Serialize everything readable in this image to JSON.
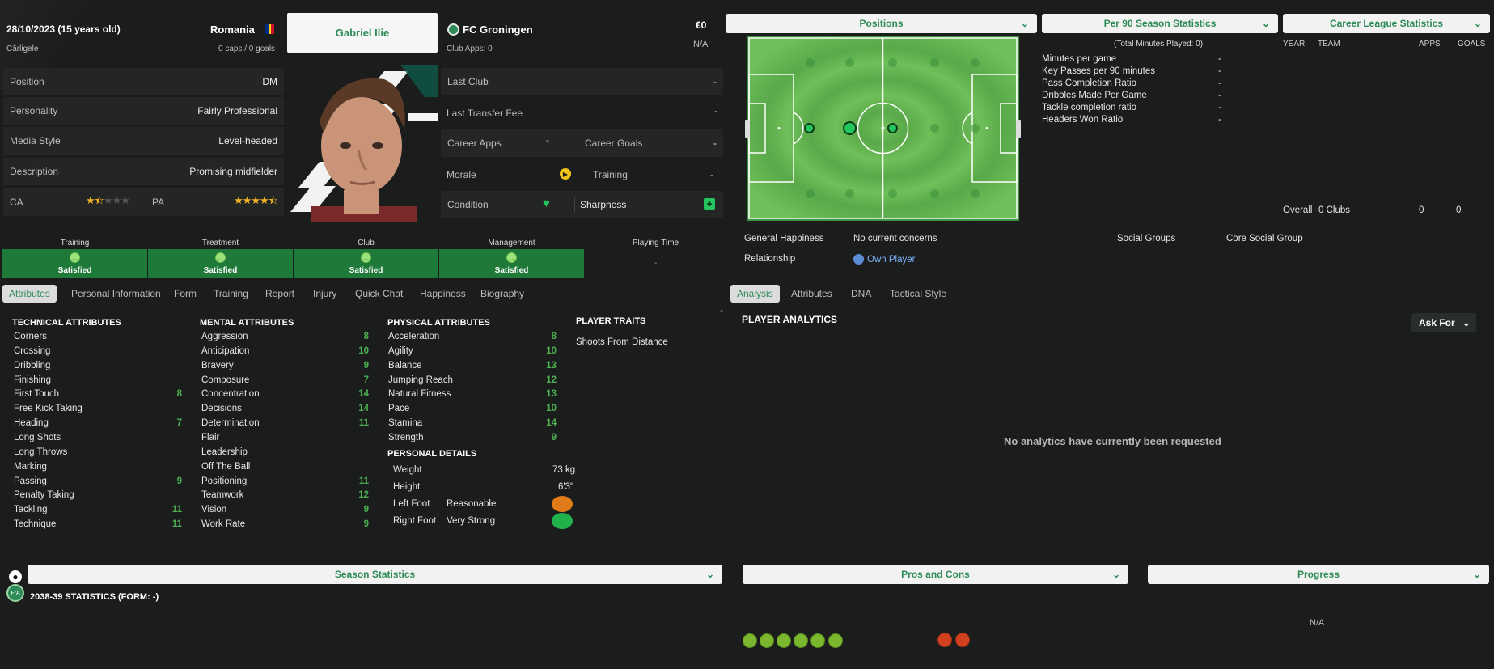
{
  "profile": {
    "dob": "28/10/2023 (15 years old)",
    "birthplace": "Cărligele",
    "nation": "Romania",
    "caps": "0 caps / 0 goals",
    "name": "Gabriel Ilie",
    "rows": [
      {
        "label": "Position",
        "value": "DM"
      },
      {
        "label": "Personality",
        "value": "Fairly Professional"
      },
      {
        "label": "Media Style",
        "value": "Level-headed"
      },
      {
        "label": "Description",
        "value": "Promising midfielder"
      }
    ],
    "ca_label": "CA",
    "pa_label": "PA",
    "ca_stars": 1.5,
    "pa_stars": 4.5
  },
  "club": {
    "name": "FC Groningen",
    "apps": "Club Apps: 0",
    "value": "€0",
    "contract": "N/A",
    "last_club_label": "Last Club",
    "last_club_value": "-",
    "last_fee_label": "Last Transfer Fee",
    "last_fee_value": "-",
    "career_apps_label": "Career Apps",
    "career_apps_value": "-",
    "career_goals_label": "Career Goals",
    "career_goals_value": "-",
    "morale_label": "Morale",
    "training_label": "Training",
    "training_value": "-",
    "condition_label": "Condition",
    "sharpness_label": "Sharpness"
  },
  "status": {
    "items": [
      {
        "label": "Training",
        "value": "Satisfied"
      },
      {
        "label": "Treatment",
        "value": "Satisfied"
      },
      {
        "label": "Club",
        "value": "Satisfied"
      },
      {
        "label": "Management",
        "value": "Satisfied"
      }
    ],
    "playing_time_label": "Playing Time",
    "playing_time_value": "-"
  },
  "tabs_left": [
    "Attributes",
    "Personal Information",
    "Form",
    "Training",
    "Report",
    "Injury",
    "Quick Chat",
    "Happiness",
    "Biography"
  ],
  "tabs_right": [
    "Analysis",
    "Attributes",
    "DNA",
    "Tactical Style"
  ],
  "technical": {
    "heading": "TECHNICAL ATTRIBUTES",
    "items": [
      {
        "name": "Corners",
        "value": ""
      },
      {
        "name": "Crossing",
        "value": ""
      },
      {
        "name": "Dribbling",
        "value": ""
      },
      {
        "name": "Finishing",
        "value": ""
      },
      {
        "name": "First Touch",
        "value": "8"
      },
      {
        "name": "Free Kick Taking",
        "value": ""
      },
      {
        "name": "Heading",
        "value": "7"
      },
      {
        "name": "Long Shots",
        "value": ""
      },
      {
        "name": "Long Throws",
        "value": ""
      },
      {
        "name": "Marking",
        "value": ""
      },
      {
        "name": "Passing",
        "value": "9"
      },
      {
        "name": "Penalty Taking",
        "value": ""
      },
      {
        "name": "Tackling",
        "value": "11"
      },
      {
        "name": "Technique",
        "value": "11"
      }
    ]
  },
  "mental": {
    "heading": "MENTAL ATTRIBUTES",
    "items": [
      {
        "name": "Aggression",
        "value": "8"
      },
      {
        "name": "Anticipation",
        "value": "10"
      },
      {
        "name": "Bravery",
        "value": "9"
      },
      {
        "name": "Composure",
        "value": "7"
      },
      {
        "name": "Concentration",
        "value": "14"
      },
      {
        "name": "Decisions",
        "value": "14"
      },
      {
        "name": "Determination",
        "value": "11"
      },
      {
        "name": "Flair",
        "value": ""
      },
      {
        "name": "Leadership",
        "value": ""
      },
      {
        "name": "Off The Ball",
        "value": ""
      },
      {
        "name": "Positioning",
        "value": "11"
      },
      {
        "name": "Teamwork",
        "value": "12"
      },
      {
        "name": "Vision",
        "value": "9"
      },
      {
        "name": "Work Rate",
        "value": "9"
      }
    ]
  },
  "physical": {
    "heading": "PHYSICAL ATTRIBUTES",
    "items": [
      {
        "name": "Acceleration",
        "value": "8"
      },
      {
        "name": "Agility",
        "value": "10"
      },
      {
        "name": "Balance",
        "value": "13"
      },
      {
        "name": "Jumping Reach",
        "value": "12"
      },
      {
        "name": "Natural Fitness",
        "value": "13"
      },
      {
        "name": "Pace",
        "value": "10"
      },
      {
        "name": "Stamina",
        "value": "14"
      },
      {
        "name": "Strength",
        "value": "9"
      }
    ]
  },
  "personal": {
    "heading": "PERSONAL DETAILS",
    "weight_label": "Weight",
    "weight": "73 kg",
    "height_label": "Height",
    "height": "6'3\"",
    "left_foot_label": "Left Foot",
    "left_foot": "Reasonable",
    "right_foot_label": "Right Foot",
    "right_foot": "Very Strong"
  },
  "traits": {
    "heading": "PLAYER TRAITS",
    "items": [
      "Shoots From Distance"
    ]
  },
  "dropdowns": {
    "positions": "Positions",
    "per90": "Per 90 Season Statistics",
    "career": "Career League Statistics",
    "season": "Season Statistics",
    "pros": "Pros and Cons",
    "progress": "Progress"
  },
  "per90": {
    "total": "(Total Minutes Played: 0)",
    "items": [
      {
        "name": "Minutes per game",
        "value": "-"
      },
      {
        "name": "Key Passes per 90 minutes",
        "value": "-"
      },
      {
        "name": "Pass Completion Ratio",
        "value": "-"
      },
      {
        "name": "Dribbles Made Per Game",
        "value": "-"
      },
      {
        "name": "Tackle completion ratio",
        "value": "-"
      },
      {
        "name": "Headers Won Ratio",
        "value": "-"
      }
    ]
  },
  "career": {
    "headers": [
      "YEAR",
      "TEAM",
      "APPS",
      "GOALS"
    ],
    "overall_label": "Overall",
    "overall_team": "0 Clubs",
    "overall_apps": "0",
    "overall_goals": "0"
  },
  "happiness": {
    "general_label": "General Happiness",
    "general_value": "No current concerns",
    "relationship_label": "Relationship",
    "relationship_value": "Own Player",
    "social_label": "Social Groups",
    "social_value": "Core Social Group"
  },
  "analytics": {
    "heading": "PLAYER ANALYTICS",
    "ask_for": "Ask For",
    "empty": "No analytics have currently been requested"
  },
  "season": {
    "title": "2038-39 STATISTICS (FORM: -)",
    "badge": "FrA"
  },
  "progress": {
    "value": "N/A"
  },
  "colors": {
    "accent": "#2e8b57",
    "status_green": "#1f7a3a",
    "pitch": "#4caf50"
  }
}
